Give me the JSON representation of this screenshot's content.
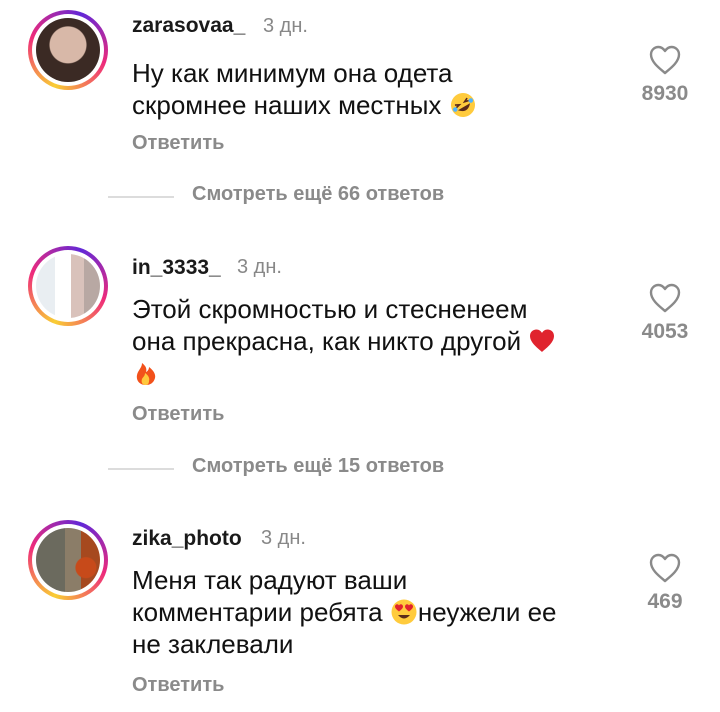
{
  "comments": [
    {
      "username": "zarasovaa_",
      "time": "3 дн.",
      "text_line1": "Ну как минимум она одета",
      "text_line2": "скромнее наших местных",
      "emoji": "rolling-on-floor-laughing-emoji",
      "reply_label": "Ответить",
      "likes": "8930"
    },
    {
      "username": "in_3333_",
      "time": "3 дн.",
      "text_line1": "Этой скромностью и стесненеем",
      "text_line2": "она прекрасна, как никто другой",
      "emoji": "red-heart-emoji",
      "emoji2": "fire-emoji",
      "reply_label": "Ответить",
      "likes": "4053"
    },
    {
      "username": "zika_photo",
      "time": "3 дн.",
      "text_line1": "Меня так радуют ваши",
      "text_line2a": "комментарии ребята",
      "text_line2b": "неужели  ее",
      "text_line3": "не заклевали",
      "emoji": "heart-eyes-emoji",
      "reply_label": "Ответить",
      "likes": "469"
    }
  ],
  "view_more": [
    {
      "label": "Смотреть ещё 66 ответов"
    },
    {
      "label": "Смотреть ещё 15 ответов"
    }
  ],
  "colors": {
    "muted": "#8a8a8a",
    "ring_start": "#f9ce34",
    "ring_mid": "#ee2a7b",
    "ring_end": "#6228d7"
  }
}
